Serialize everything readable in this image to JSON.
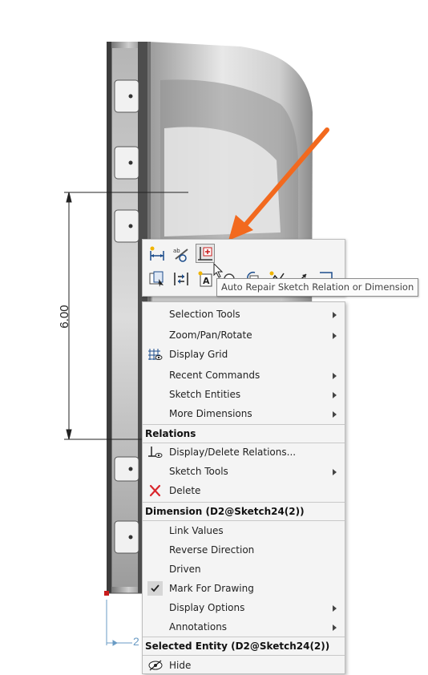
{
  "drawing": {
    "dimension_value": "6.00",
    "bottom_dimension_partial": "2"
  },
  "tooltip": {
    "text": "Auto Repair Sketch Relation or Dimension"
  },
  "toolbar": {
    "row1_icons": [
      "smart-dimension-icon",
      "dimxpert-icon",
      "auto-repair-icon"
    ],
    "row2_icons": [
      "select-other-icon",
      "flip-dimension-icon",
      "note-icon",
      "link-dimension-icon",
      "rotate-view-icon",
      "sketch-tools-icon",
      "trim-icon",
      "corner-icon"
    ]
  },
  "menu": {
    "items_top": [
      {
        "label": "Selection Tools",
        "submenu": true
      },
      {
        "label": "Zoom/Pan/Rotate",
        "submenu": true
      },
      {
        "label": "Display Grid",
        "submenu": false,
        "icon": "grid-icon"
      },
      {
        "label": "Recent Commands",
        "submenu": true
      },
      {
        "label": "Sketch Entities",
        "submenu": true
      },
      {
        "label": "More Dimensions",
        "submenu": true
      }
    ],
    "relations_header": "Relations",
    "relations_items": [
      {
        "label": "Display/Delete Relations...",
        "submenu": false,
        "icon": "relations-icon"
      },
      {
        "label": "Sketch Tools",
        "submenu": true
      },
      {
        "label": "Delete",
        "submenu": false,
        "icon": "delete-x-icon"
      }
    ],
    "dimension_header": "Dimension (D2@Sketch24(2))",
    "dimension_items": [
      {
        "label": "Link Values",
        "submenu": false
      },
      {
        "label": "Reverse Direction",
        "submenu": false
      },
      {
        "label": "Driven",
        "submenu": false
      },
      {
        "label": "Mark For Drawing",
        "submenu": false,
        "checked": true
      },
      {
        "label": "Display Options",
        "submenu": true
      },
      {
        "label": "Annotations",
        "submenu": true
      }
    ],
    "selected_header": "Selected Entity (D2@Sketch24(2))",
    "selected_items": [
      {
        "label": "Hide",
        "submenu": false,
        "icon": "hide-eye-icon"
      }
    ]
  },
  "colors": {
    "annotation_arrow": "#f2691e",
    "menu_bg": "#f4f4f4",
    "delete_red": "#d9262c",
    "dimension_blue": "#6a9bc4"
  }
}
